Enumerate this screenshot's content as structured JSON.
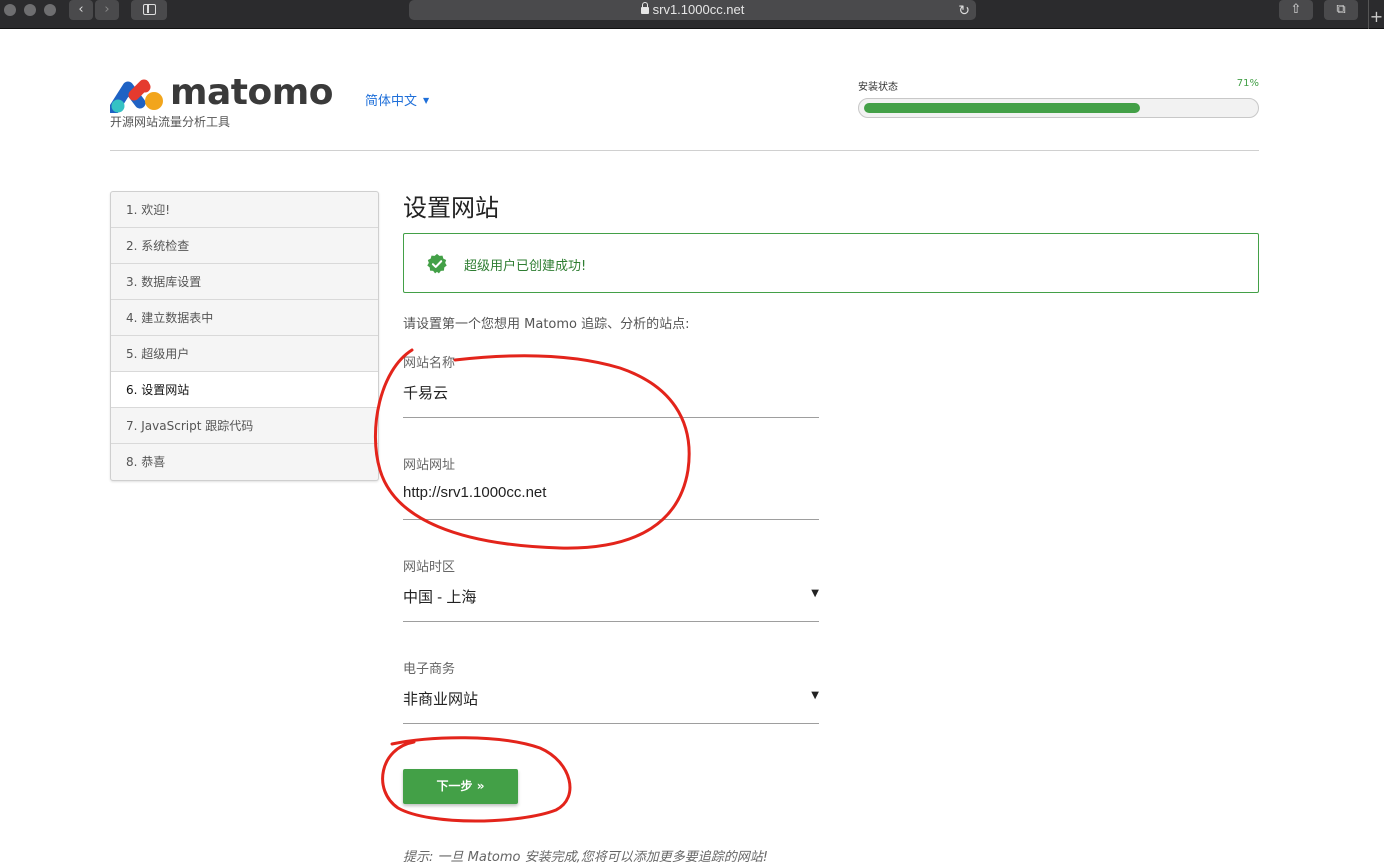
{
  "browser": {
    "url": "srv1.1000cc.net",
    "back_glyph": "‹",
    "forward_glyph": "›",
    "reload_glyph": "↻",
    "share_glyph": "⇧",
    "tabs_glyph": "⧉",
    "new_tab_glyph": "+"
  },
  "header": {
    "logo_text": "matomo",
    "tagline": "开源网站流量分析工具",
    "language": "简体中文",
    "language_caret": "▼",
    "progress_label": "安装状态",
    "progress_text": "71%",
    "progress_value": 0.71
  },
  "steps": [
    {
      "label": "1. 欢迎!"
    },
    {
      "label": "2. 系统检查"
    },
    {
      "label": "3. 数据库设置"
    },
    {
      "label": "4. 建立数据表中"
    },
    {
      "label": "5. 超级用户"
    },
    {
      "label": "6. 设置网站",
      "current": true
    },
    {
      "label": "7. JavaScript 跟踪代码"
    },
    {
      "label": "8. 恭喜"
    }
  ],
  "main": {
    "title": "设置网站",
    "success_message": "超级用户已创建成功!",
    "intro": "请设置第一个您想用 Matomo 追踪、分析的站点:",
    "fields": {
      "site_name": {
        "label": "网站名称",
        "value": "千易云"
      },
      "site_url": {
        "label": "网站网址",
        "value": "http://srv1.1000cc.net"
      },
      "timezone": {
        "label": "网站时区",
        "value": "中国 - 上海",
        "caret": "▼"
      },
      "ecommerce": {
        "label": "电子商务",
        "value": "非商业网站",
        "caret": "▼"
      }
    },
    "next_button": "下一步 »",
    "hint": "提示: 一旦 Matomo 安装完成,您将可以添加更多要追踪的网站!"
  },
  "colors": {
    "accent_green": "#43a047",
    "link_blue": "#1e6fd9",
    "annotation_red": "#e3241b"
  }
}
